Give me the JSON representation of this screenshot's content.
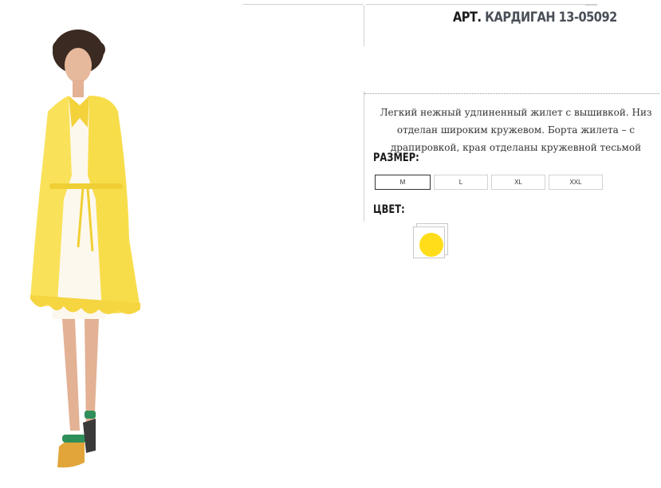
{
  "product": {
    "title_prefix": "АРТ.",
    "title_name": "КАРДИГАН 13-05092",
    "description": "Легкий нежный удлиненный жилет с вышивкой. Низ отделан широким кружевом. Борта жилета – с драпировкой, края отделаны кружевной тесьмой",
    "photo_icon": "model-in-yellow-cardigan-photo"
  },
  "size": {
    "label": "РАЗМЕР:",
    "options": [
      "M",
      "L",
      "XL",
      "XXL"
    ],
    "selected": "M"
  },
  "color": {
    "label": "ЦВЕТ:",
    "swatches": [
      {
        "hex": "#ffdd1a",
        "selected": true
      }
    ]
  },
  "colors": {
    "title_name": "#4a4f57",
    "cardigan": "#f9e25a",
    "dress": "#fdf8ee"
  }
}
